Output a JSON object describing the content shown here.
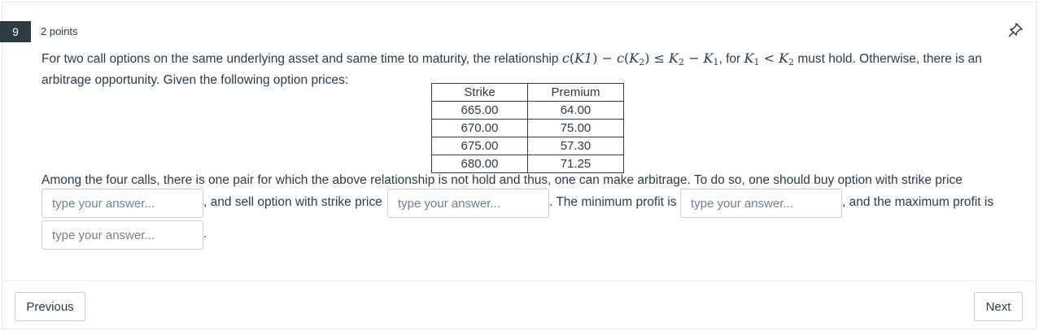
{
  "question": {
    "number": "9",
    "points": "2 points",
    "intro_before_math": "For two call options on the same underlying asset and same time to maturity, the relationship ",
    "intro_after_math": " must hold. Otherwise, there is an",
    "intro_line2": "arbitrage opportunity. Given the following option prices:",
    "math_parts": {
      "c1": "c",
      "p_open1": "(",
      "k1": "K1",
      "p_close1": ")",
      "minus1": " − ",
      "c2": "c",
      "p_open2": "(",
      "k2": "K",
      "k2_sub": "2",
      "p_close2": ")",
      "leq": " ≤ ",
      "k2b": "K",
      "k2b_sub": "2",
      "minus2": " − ",
      "k1b": "K",
      "k1b_sub": "1",
      "comma_for": ", for ",
      "k1c": "K",
      "k1c_sub": "1",
      "lt": " < ",
      "k2c": "K",
      "k2c_sub": "2"
    }
  },
  "price_table": {
    "headers": [
      "Strike",
      "Premium"
    ],
    "rows": [
      [
        "665.00",
        "64.00"
      ],
      [
        "670.00",
        "75.00"
      ],
      [
        "675.00",
        "57.30"
      ],
      [
        "680.00",
        "71.25"
      ]
    ]
  },
  "prompt": {
    "line1": "Among the four calls, there is one pair for which the above relationship is not hold and thus, one can make arbitrage. To do so, one should buy option with strike price",
    "after_buy": ", and sell option with strike price",
    "after_sell": ". The minimum profit is",
    "after_min": ", and the maximum profit is",
    "after_max": "."
  },
  "answers": {
    "buy_strike": {
      "placeholder": "type your answer..."
    },
    "sell_strike": {
      "placeholder": "type your answer..."
    },
    "min_profit": {
      "placeholder": "type your answer..."
    },
    "max_profit": {
      "placeholder": "type your answer..."
    }
  },
  "nav": {
    "previous": "Previous",
    "next": "Next"
  },
  "icons": {
    "pin": "pin-icon"
  },
  "colors": {
    "badge": "#2d3b45",
    "text": "#2d3b45",
    "placeholder": "#73818a",
    "border": "#c7cdd1"
  }
}
